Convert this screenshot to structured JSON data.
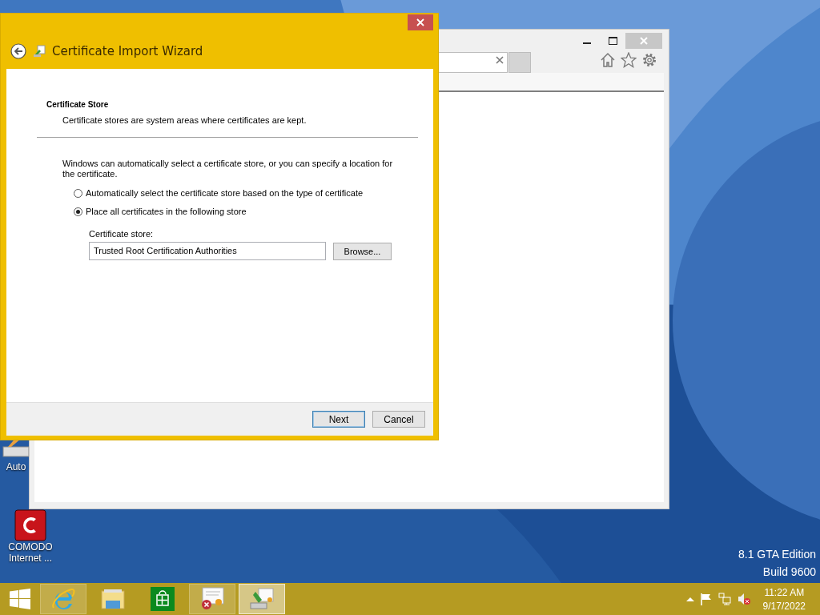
{
  "desktop_icons": [
    {
      "label": "Auto",
      "kind": "installer"
    },
    {
      "label": "COMODO Internet ...",
      "kind": "comodo"
    }
  ],
  "watermark": {
    "edition": "8.1 GTA Edition",
    "build": "Build 9600"
  },
  "dialog": {
    "title": "Certificate Import Wizard",
    "section_title": "Certificate Store",
    "section_desc": "Certificate stores are system areas where certificates are kept.",
    "intro": "Windows can automatically select a certificate store, or you can specify a location for the certificate.",
    "options": [
      {
        "label": "Automatically select the certificate store based on the type of certificate",
        "selected": false
      },
      {
        "label": "Place all certificates in the following store",
        "selected": true
      }
    ],
    "store_label": "Certificate store:",
    "store_value": "Trusted Root Certification Authorities",
    "browse": "Browse...",
    "buttons": [
      {
        "label": "Next",
        "kind": "default"
      },
      {
        "label": "Cancel",
        "kind": "normal"
      }
    ]
  },
  "taskbar": {
    "apps": [
      {
        "kind": "ie",
        "open": true,
        "selected": false
      },
      {
        "kind": "explorer",
        "open": false,
        "selected": false
      },
      {
        "kind": "store",
        "open": false,
        "selected": false
      },
      {
        "kind": "cert-error",
        "open": true,
        "selected": false
      },
      {
        "kind": "cert-wizard",
        "open": true,
        "selected": true
      }
    ],
    "time": "11:22 AM",
    "date": "9/17/2022"
  }
}
